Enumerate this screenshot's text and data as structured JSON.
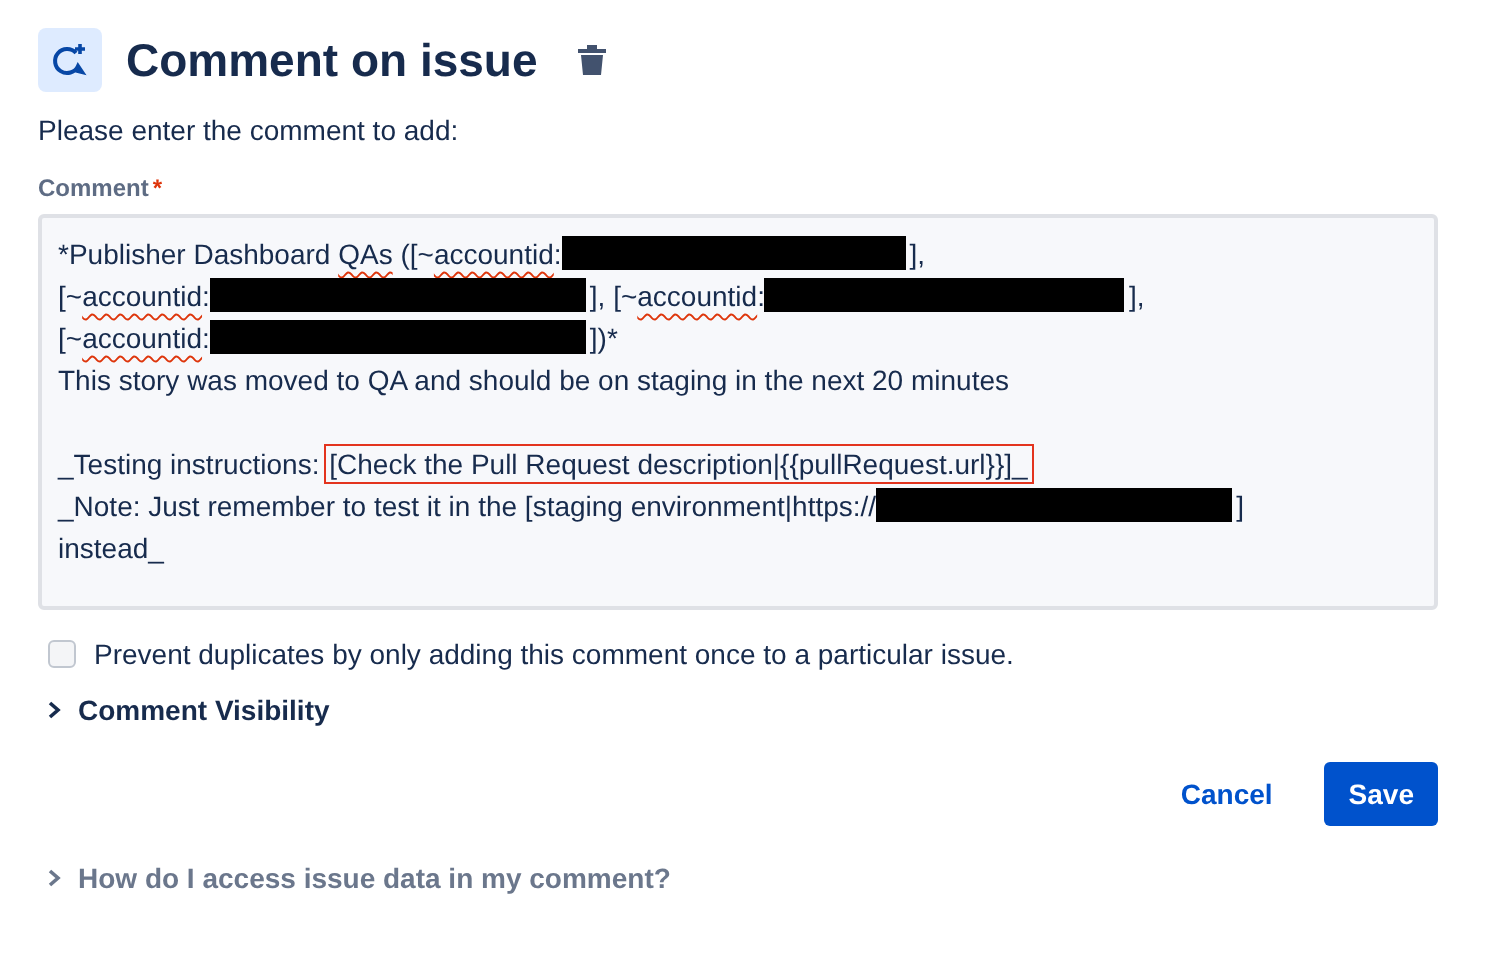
{
  "header": {
    "title": "Comment on issue"
  },
  "prompt": "Please enter the comment to add:",
  "comment_field": {
    "label": "Comment",
    "required_mark": "*",
    "lines": [
      [
        {
          "kind": "text",
          "text": "*Publisher Dashboard "
        },
        {
          "kind": "misspelled",
          "text": "QAs"
        },
        {
          "kind": "text",
          "text": " ([~"
        },
        {
          "kind": "misspelled",
          "text": "accountid"
        },
        {
          "kind": "text",
          "text": ":"
        },
        {
          "kind": "redacted"
        },
        {
          "kind": "text",
          "text": "],"
        }
      ],
      [
        {
          "kind": "text",
          "text": "[~"
        },
        {
          "kind": "misspelled",
          "text": "accountid"
        },
        {
          "kind": "text",
          "text": ":"
        },
        {
          "kind": "redacted"
        },
        {
          "kind": "text",
          "text": "], [~"
        },
        {
          "kind": "misspelled",
          "text": "accountid"
        },
        {
          "kind": "text",
          "text": ":"
        },
        {
          "kind": "redacted"
        },
        {
          "kind": "text",
          "text": "],"
        }
      ],
      [
        {
          "kind": "text",
          "text": "[~"
        },
        {
          "kind": "misspelled",
          "text": "accountid"
        },
        {
          "kind": "text",
          "text": ":"
        },
        {
          "kind": "redacted"
        },
        {
          "kind": "text",
          "text": "])*"
        }
      ],
      [
        {
          "kind": "text",
          "text": "This story was moved to QA and should be on staging in the next 20 minutes"
        }
      ],
      [
        {
          "kind": "blank"
        }
      ],
      [
        {
          "kind": "text",
          "text": "_Testing instructions: "
        },
        {
          "kind": "boxed",
          "text": "[Check the Pull Request description|{{pullRequest.url}}]_"
        }
      ],
      [
        {
          "kind": "text",
          "text": "_Note: Just remember to test it in the [staging environment|https://"
        },
        {
          "kind": "redacted"
        },
        {
          "kind": "text",
          "text": "]"
        }
      ],
      [
        {
          "kind": "text",
          "text": "instead_"
        }
      ]
    ]
  },
  "checkbox": {
    "label": "Prevent duplicates by only adding this comment once to a particular issue.",
    "checked": false
  },
  "visibility": {
    "label": "Comment Visibility",
    "expanded": false
  },
  "buttons": [
    {
      "label": "Cancel",
      "kind": "subtle"
    },
    {
      "label": "Save",
      "kind": "primary"
    }
  ],
  "help": {
    "label": "How do I access issue data in my comment?",
    "expanded": false
  }
}
